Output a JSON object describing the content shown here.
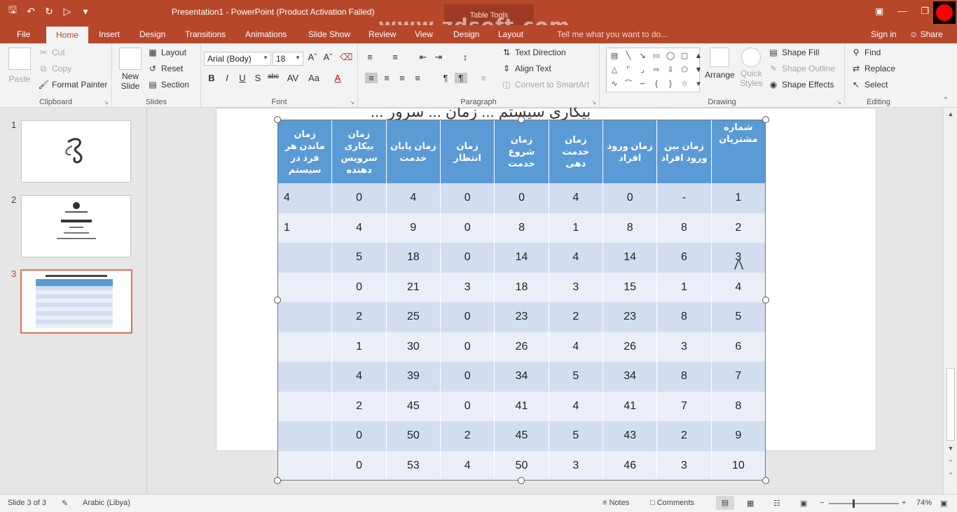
{
  "window": {
    "title": "Presentation1 - PowerPoint (Product Activation Failed)",
    "contextual_tab_group": "Table Tools",
    "watermark": "www.zdsoft.com"
  },
  "tabs": [
    {
      "label": "File"
    },
    {
      "label": "Home",
      "active": true
    },
    {
      "label": "Insert"
    },
    {
      "label": "Design"
    },
    {
      "label": "Transitions"
    },
    {
      "label": "Animations"
    },
    {
      "label": "Slide Show"
    },
    {
      "label": "Review"
    },
    {
      "label": "View"
    },
    {
      "label": "Design"
    },
    {
      "label": "Layout"
    }
  ],
  "tell_me": "Tell me what you want to do...",
  "sign_in": "Sign in",
  "share": "Share",
  "ribbon": {
    "clipboard": {
      "label": "Clipboard",
      "paste": "Paste",
      "cut": "Cut",
      "copy": "Copy",
      "format_painter": "Format Painter"
    },
    "slides": {
      "label": "Slides",
      "new_slide": "New",
      "new_slide_2": "Slide",
      "layout": "Layout",
      "reset": "Reset",
      "section": "Section"
    },
    "font": {
      "label": "Font",
      "name": "Arial (Body)",
      "size": "18"
    },
    "paragraph": {
      "label": "Paragraph",
      "text_direction": "Text Direction",
      "align_text": "Align Text",
      "convert_smartart": "Convert to SmartArt"
    },
    "drawing": {
      "label": "Drawing",
      "arrange": "Arrange",
      "quick": "Quick",
      "styles": "Styles",
      "shape_fill": "Shape Fill",
      "shape_outline": "Shape Outline",
      "shape_effects": "Shape Effects"
    },
    "editing": {
      "label": "Editing",
      "find": "Find",
      "replace": "Replace",
      "select": "Select"
    }
  },
  "thumbnails": [
    {
      "num": "1",
      "active": false
    },
    {
      "num": "2",
      "active": false
    },
    {
      "num": "3",
      "active": true
    }
  ],
  "slide": {
    "title_partial": "بیکاری سیستم ... زمان ... سرور ..."
  },
  "table": {
    "headers": [
      "شماره مشتریان",
      "زمان بین ورود افراد",
      "زمان ورود افراد",
      "زمان خدمت دهی",
      "زمان شروع خدمت",
      "زمان انتظار",
      "زمان پایان خدمت",
      "زمان بیکاری سرویس دهنده",
      "زمان ماندن هر فرد در سیستم"
    ],
    "rows": [
      [
        "1",
        "-",
        "0",
        "4",
        "0",
        "0",
        "4",
        "0",
        "4"
      ],
      [
        "2",
        "8",
        "8",
        "1",
        "8",
        "0",
        "9",
        "4",
        "1"
      ],
      [
        "3",
        "6",
        "14",
        "4",
        "14",
        "0",
        "18",
        "5",
        ""
      ],
      [
        "4",
        "1",
        "15",
        "3",
        "18",
        "3",
        "21",
        "0",
        ""
      ],
      [
        "5",
        "8",
        "23",
        "2",
        "23",
        "0",
        "25",
        "2",
        ""
      ],
      [
        "6",
        "3",
        "26",
        "4",
        "26",
        "0",
        "30",
        "1",
        ""
      ],
      [
        "7",
        "8",
        "34",
        "5",
        "34",
        "0",
        "39",
        "4",
        ""
      ],
      [
        "8",
        "7",
        "41",
        "4",
        "41",
        "0",
        "45",
        "2",
        ""
      ],
      [
        "9",
        "2",
        "43",
        "5",
        "45",
        "2",
        "50",
        "0",
        ""
      ],
      [
        "10",
        "3",
        "46",
        "3",
        "50",
        "4",
        "53",
        "0",
        ""
      ]
    ]
  },
  "status": {
    "slide_info": "Slide 3 of 3",
    "language": "Arabic (Libya)",
    "notes": "Notes",
    "comments": "Comments",
    "zoom": "74%"
  },
  "colors": {
    "accent": "#b7472a",
    "table_header": "#5b9bd5",
    "row_dark": "#d2def0",
    "row_light": "#eaeff7"
  }
}
